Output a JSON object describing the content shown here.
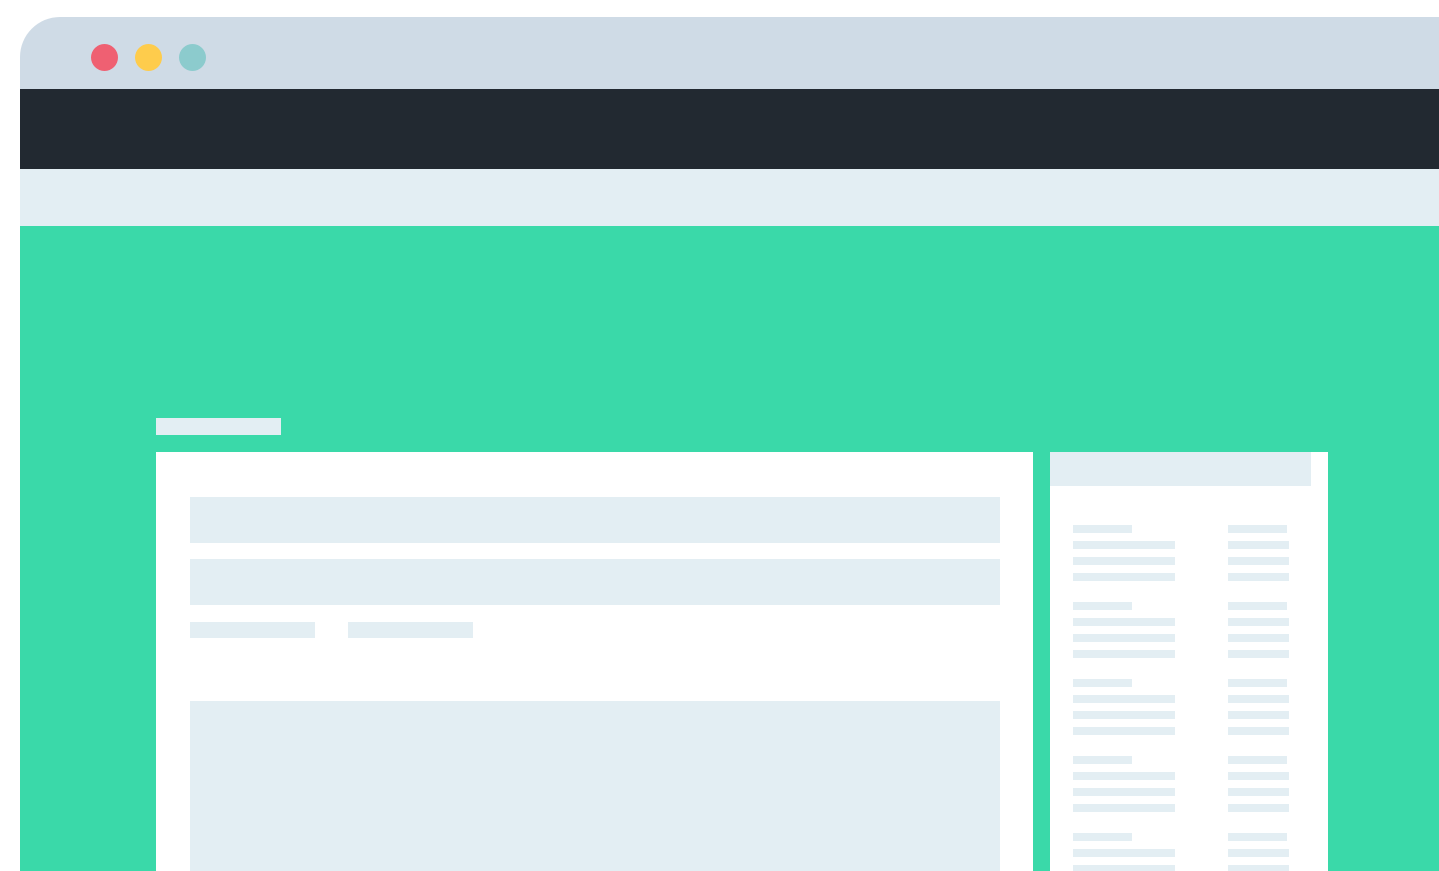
{
  "window": {
    "controls": [
      {
        "name": "close",
        "color": "#ef6072"
      },
      {
        "name": "minimize",
        "color": "#fecc4c"
      },
      {
        "name": "zoom",
        "color": "#8ccbcd"
      }
    ]
  },
  "colors": {
    "titlebar": "#cfdbe6",
    "nav": "#222931",
    "subnav": "#e3eef3",
    "hero": "#3ad9a9",
    "placeholder": "#e3eef3",
    "card": "#ffffff"
  },
  "sidebar": {
    "groups": 5,
    "rows_per_group": 4
  }
}
